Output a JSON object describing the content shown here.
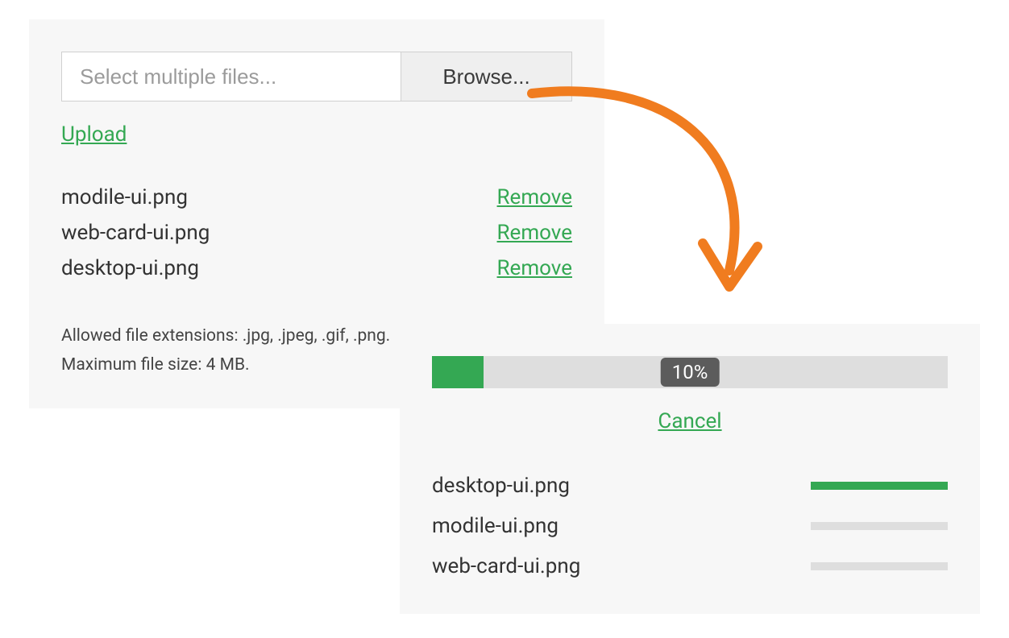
{
  "select_panel": {
    "placeholder": "Select multiple files...",
    "browse_label": "Browse...",
    "upload_label": "Upload",
    "files": [
      {
        "name": "modile-ui.png",
        "action": "Remove"
      },
      {
        "name": "web-card-ui.png",
        "action": "Remove"
      },
      {
        "name": "desktop-ui.png",
        "action": "Remove"
      }
    ],
    "rule_extensions": "Allowed file extensions: .jpg, .jpeg, .gif, .png.",
    "rule_size": "Maximum file size: 4 MB."
  },
  "progress_panel": {
    "overall_percent": 10,
    "overall_label": "10%",
    "cancel_label": "Cancel",
    "files": [
      {
        "name": "desktop-ui.png",
        "percent": 100
      },
      {
        "name": "modile-ui.png",
        "percent": 0
      },
      {
        "name": "web-card-ui.png",
        "percent": 0
      }
    ]
  },
  "colors": {
    "green": "#34a853",
    "arrow": "#f07c1f",
    "bar_bg": "#dedede",
    "panel_bg": "#f7f7f7"
  }
}
